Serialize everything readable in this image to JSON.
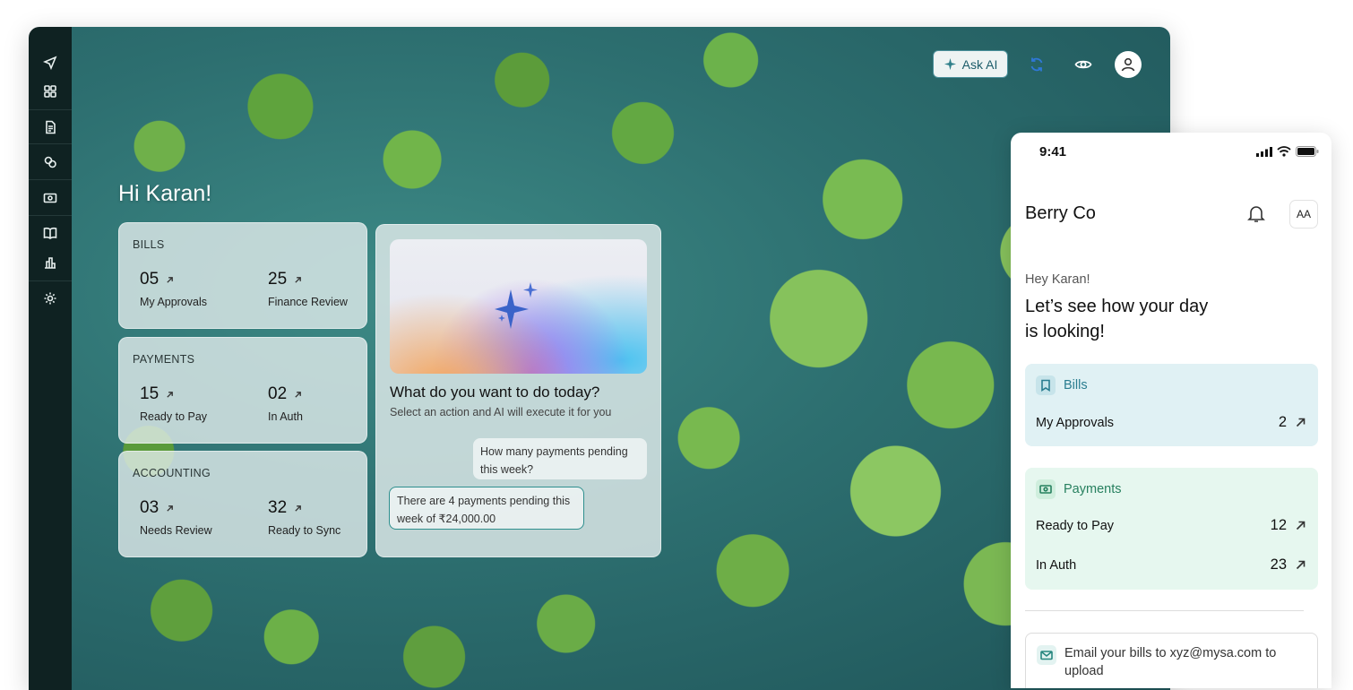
{
  "desktop": {
    "toolbar": {
      "ask_ai_label": "Ask AI"
    },
    "greeting": "Hi Karan!",
    "cards": [
      {
        "title": "BILLS",
        "stats": [
          {
            "value": "05",
            "label": "My Approvals"
          },
          {
            "value": "25",
            "label": "Finance Review"
          }
        ]
      },
      {
        "title": "PAYMENTS",
        "stats": [
          {
            "value": "15",
            "label": "Ready to Pay"
          },
          {
            "value": "02",
            "label": "In Auth"
          }
        ]
      },
      {
        "title": "ACCOUNTING",
        "stats": [
          {
            "value": "03",
            "label": "Needs Review"
          },
          {
            "value": "32",
            "label": "Ready to Sync"
          }
        ]
      }
    ],
    "ai": {
      "question": "What do you want to do today?",
      "subtitle": "Select an action and AI will execute it for you",
      "user_message": "How many payments pending this week?",
      "ai_message": "There are 4 payments pending this week of ₹24,000.00"
    },
    "sidebar_icons": [
      "send-icon",
      "grid-icon",
      "document-icon",
      "contacts-icon",
      "bill-icon",
      "book-icon",
      "chart-icon",
      "gear-icon"
    ],
    "toolbar_icons": [
      "sparkle-icon",
      "refresh-icon",
      "eye-icon",
      "user-icon"
    ]
  },
  "mobile": {
    "time": "9:41",
    "company": "Berry Co",
    "avatar_initials": "AA",
    "hey": "Hey Karan!",
    "headline": "Let’s see how your day is looking!",
    "bills": {
      "title": "Bills",
      "rows": [
        {
          "label": "My Approvals",
          "value": "2"
        }
      ]
    },
    "payments": {
      "title": "Payments",
      "rows": [
        {
          "label": "Ready to Pay",
          "value": "12"
        },
        {
          "label": "In Auth",
          "value": "23"
        }
      ]
    },
    "email_text": "Email your bills to xyz@mysa.com to upload"
  },
  "colors": {
    "sidebar": "#0f2222",
    "accent_teal": "#2e8f8e",
    "bills_bg": "#e0f1f4",
    "payments_bg": "#e6f7ef"
  }
}
